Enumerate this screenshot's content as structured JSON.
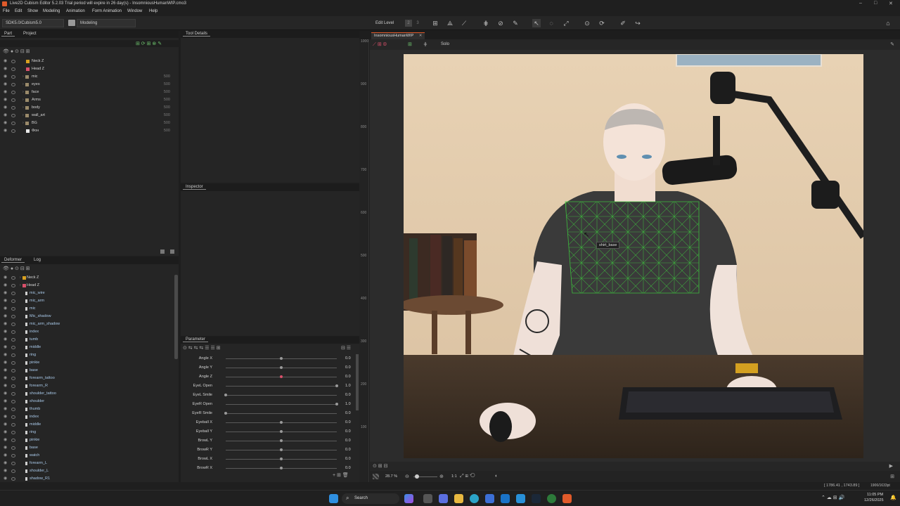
{
  "window": {
    "title": "Live2D Cubism Editor 5.2.03   Trial period will expire in 26 day(s)  - InsomniousHumanWIP.cmo3",
    "controls": [
      "–",
      "□",
      "✕"
    ]
  },
  "menu": [
    "File",
    "Edit",
    "Show",
    "Modeling",
    "Animation",
    "Form Animation",
    "Window",
    "Help"
  ],
  "toolbar": {
    "sdk_combo": "SDK5.0/Cubism5.0",
    "mode_combo": "Modeling",
    "edit_level_label": "Edit Level",
    "edit_levels": [
      "1",
      "2",
      "3"
    ]
  },
  "part_panel": {
    "tabs": [
      "Part",
      "Project"
    ],
    "rows": [
      {
        "label": "Neck Z",
        "num": ""
      },
      {
        "label": "Head Z",
        "num": ""
      },
      {
        "label": "mic",
        "num": "500"
      },
      {
        "label": "eyes",
        "num": "500"
      },
      {
        "label": "face",
        "num": "500"
      },
      {
        "label": "Arms",
        "num": "500"
      },
      {
        "label": "body",
        "num": "500"
      },
      {
        "label": "wall_art",
        "num": "500"
      },
      {
        "label": "BG",
        "num": "500"
      },
      {
        "label": "Фон",
        "num": "500"
      }
    ]
  },
  "tool_details": {
    "title": "Tool Details"
  },
  "inspector": {
    "title": "Inspector"
  },
  "deformer_panel": {
    "tabs": [
      "Deformer",
      "Log"
    ],
    "rows": [
      "Neck Z",
      "Head Z",
      "mic_wire",
      "mic_arm",
      "mic",
      "Mic_shadow",
      "mic_arm_shadow",
      "index",
      "tumb",
      "middle",
      "ring",
      "pinkie",
      "base",
      "forearm_tattoo",
      "forearm_R",
      "shoulder_tattoo",
      "shoulder",
      "thumb",
      "index",
      "middle",
      "ring",
      "pinkie",
      "base",
      "watch",
      "forearm_L",
      "shoulder_L",
      "shadow_R1"
    ]
  },
  "parameter_panel": {
    "title": "Parameter",
    "params": [
      {
        "name": "Angle X",
        "value": "0.0",
        "pos": 0.5
      },
      {
        "name": "Angle Y",
        "value": "0.0",
        "pos": 0.5
      },
      {
        "name": "Angle Z",
        "value": "0.0",
        "pos": 0.5
      },
      {
        "name": "EyeL Open",
        "value": "1.0",
        "pos": 1.0
      },
      {
        "name": "EyeL Smile",
        "value": "0.0",
        "pos": 0.0
      },
      {
        "name": "EyeR Open",
        "value": "1.0",
        "pos": 1.0
      },
      {
        "name": "EyeR Smile",
        "value": "0.0",
        "pos": 0.0
      },
      {
        "name": "Eyeball X",
        "value": "0.0",
        "pos": 0.5
      },
      {
        "name": "Eyeball Y",
        "value": "0.0",
        "pos": 0.5
      },
      {
        "name": "BrowL Y",
        "value": "0.0",
        "pos": 0.5
      },
      {
        "name": "BrowR Y",
        "value": "0.0",
        "pos": 0.5
      },
      {
        "name": "BrowL X",
        "value": "0.0",
        "pos": 0.5
      },
      {
        "name": "BrowR X",
        "value": "0.0",
        "pos": 0.5
      }
    ]
  },
  "viewport": {
    "tab": "InsomniousHumanWIP",
    "solo_label": "Solo",
    "tooltip": "shirt_base",
    "ruler": [
      "1000",
      "900",
      "800",
      "700",
      "600",
      "500",
      "400",
      "300",
      "200",
      "100"
    ],
    "zoom": "28.7 %",
    "scale_label": "1:1",
    "coords": "[ 1786.41 , 1743.89 ]",
    "canvas_size": "1906/1633pt"
  },
  "taskbar": {
    "search_placeholder": "Search",
    "time": "11:05 PM",
    "date": "12/26/2025"
  },
  "colors": {
    "accent": "#e05a2a",
    "mesh": "#3ecb3e",
    "knob_active": "#d9506a"
  }
}
